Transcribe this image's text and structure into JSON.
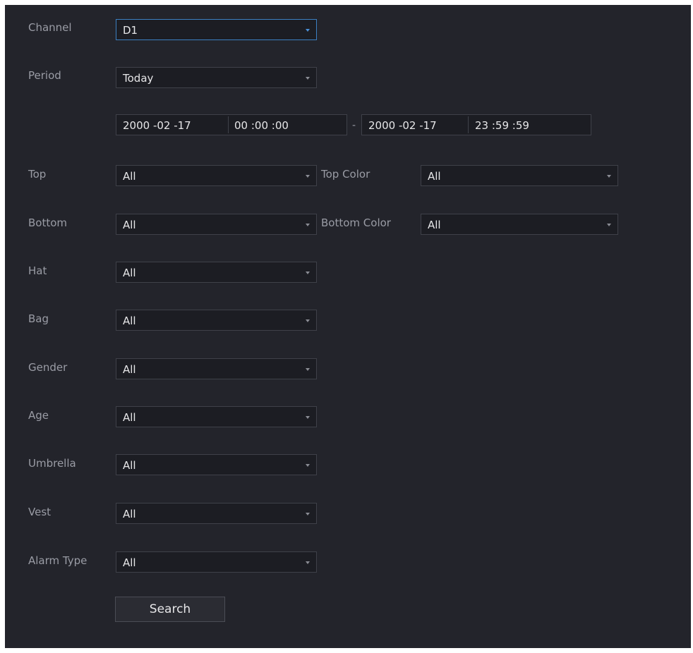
{
  "channel": {
    "label": "Channel",
    "value": "D1"
  },
  "period": {
    "label": "Period",
    "value": "Today"
  },
  "time_range": {
    "start_date": "2000 -02 -17",
    "start_time": "00 :00 :00",
    "separator": "-",
    "end_date": "2000 -02 -17",
    "end_time": "23 :59 :59"
  },
  "top": {
    "label": "Top",
    "value": "All"
  },
  "top_color": {
    "label": "Top Color",
    "value": "All"
  },
  "bottom": {
    "label": "Bottom",
    "value": "All"
  },
  "bottom_color": {
    "label": "Bottom Color",
    "value": "All"
  },
  "hat": {
    "label": "Hat",
    "value": "All"
  },
  "bag": {
    "label": "Bag",
    "value": "All"
  },
  "gender": {
    "label": "Gender",
    "value": "All"
  },
  "age": {
    "label": "Age",
    "value": "All"
  },
  "umbrella": {
    "label": "Umbrella",
    "value": "All"
  },
  "vest": {
    "label": "Vest",
    "value": "All"
  },
  "alarm_type": {
    "label": "Alarm Type",
    "value": "All"
  },
  "search_button": {
    "label": "Search"
  },
  "colors": {
    "background": "#23242b",
    "field": "#1c1d23",
    "focus_border": "#3c7fc2",
    "label_text": "#9a9ca5"
  }
}
